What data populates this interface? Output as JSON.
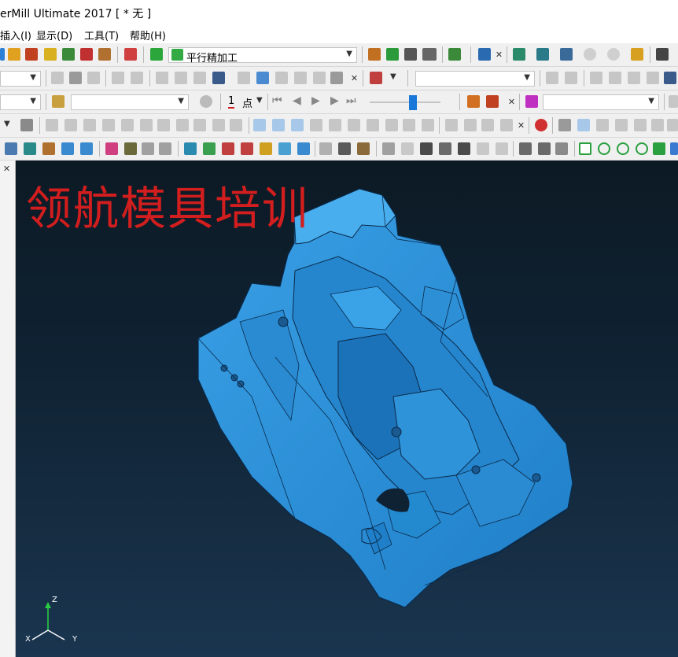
{
  "window": {
    "title": "erMill Ultimate 2017   [ * 无 ]"
  },
  "menu": {
    "items": [
      {
        "label": "插入(I)"
      },
      {
        "label": "显示(D)"
      },
      {
        "label": "工具(T)"
      },
      {
        "label": "帮助(H)"
      }
    ]
  },
  "toolbar": {
    "strategy_combo_value": "平行精加工",
    "point_combo_value": "点",
    "point_index": "1"
  },
  "viewport": {
    "watermark": "领航模具培训",
    "axes": {
      "z": "Z",
      "x": "X",
      "y": "Y"
    }
  },
  "colors": {
    "model": "#2b8fd6",
    "watermark": "#d21e1e",
    "background_top": "#0c1a24",
    "background_bottom": "#1a3550"
  }
}
